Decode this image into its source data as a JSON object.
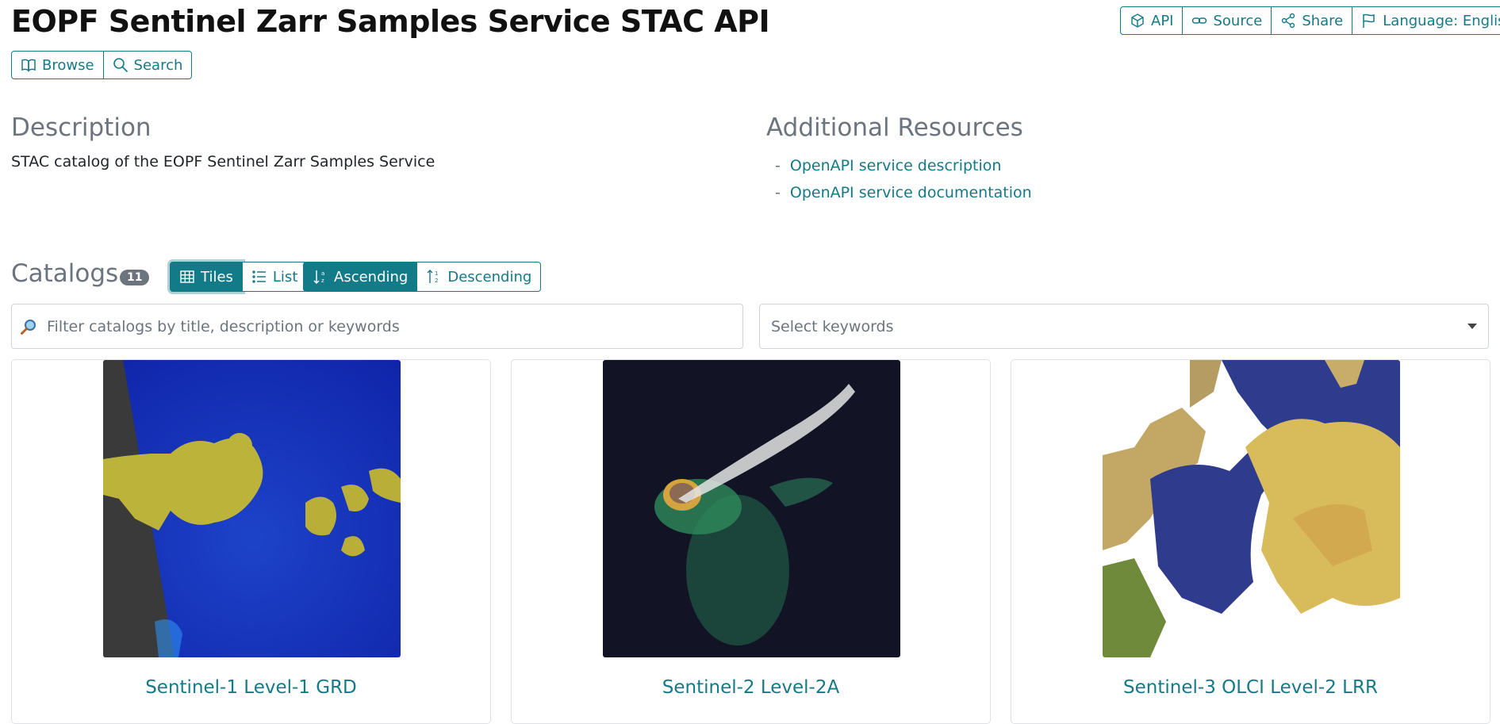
{
  "header": {
    "title": "EOPF Sentinel Zarr Samples Service STAC API",
    "nav": [
      {
        "label": "Browse",
        "icon": "book-icon"
      },
      {
        "label": "Search",
        "icon": "search-icon"
      }
    ],
    "actions": [
      {
        "label": "API",
        "icon": "cube-icon"
      },
      {
        "label": "Source",
        "icon": "link-icon"
      },
      {
        "label": "Share",
        "icon": "share-icon"
      },
      {
        "label": "Language: English",
        "icon": "flag-icon"
      }
    ]
  },
  "description": {
    "heading": "Description",
    "text": "STAC catalog of the EOPF Sentinel Zarr Samples Service"
  },
  "resources": {
    "heading": "Additional Resources",
    "links": [
      "OpenAPI service description",
      "OpenAPI service documentation"
    ]
  },
  "catalogs": {
    "heading": "Catalogs",
    "count": "11",
    "view_tiles": "Tiles",
    "view_list": "List",
    "sort_asc": "Ascending",
    "sort_desc": "Descending",
    "filter_placeholder": "Filter catalogs by title, description or keywords",
    "keywords_placeholder": "Select keywords",
    "items": [
      {
        "title": "Sentinel-1 Level-1 GRD"
      },
      {
        "title": "Sentinel-2 Level-2A"
      },
      {
        "title": "Sentinel-3 OLCI Level-2 LRR"
      }
    ]
  },
  "colors": {
    "accent": "#137a87",
    "muted": "#6c757d"
  }
}
